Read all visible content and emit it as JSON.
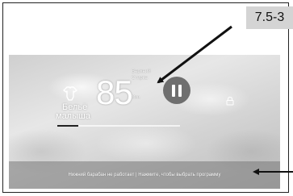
{
  "callout": {
    "label": "7.5-3"
  },
  "screen": {
    "program_label_line1": "Бельё",
    "program_label_line2": "малыша",
    "time_value": "85",
    "time_unit": "Мин.",
    "drum_label_line1": "Верхний",
    "drum_label_line2": "Стирка",
    "progress_fraction": 0.17,
    "status_message": "Нижний барабан не работает | Нажмите, чтобы выбрать программу"
  },
  "icons": {
    "program": "baby-bodysuit-icon",
    "pause": "pause-icon",
    "lock": "lock-icon",
    "arrows": "callout-arrow-icon"
  }
}
